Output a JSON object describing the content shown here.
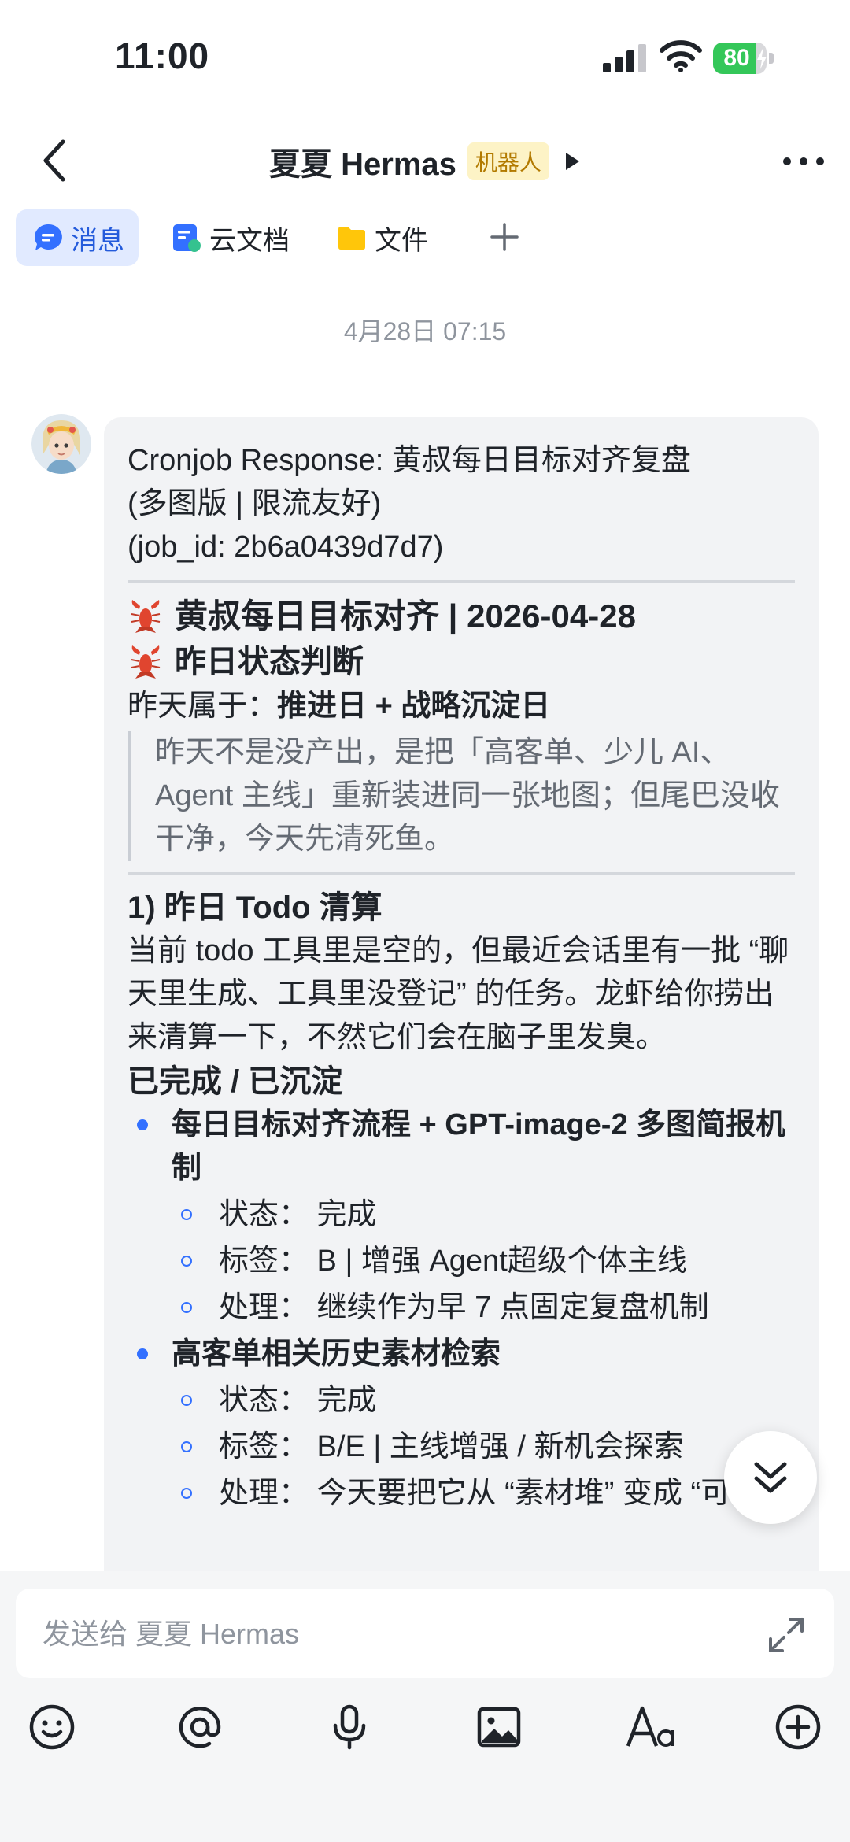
{
  "status_bar": {
    "time": "11:00",
    "battery": 80
  },
  "header": {
    "title": "夏夏 Hermas",
    "badge": "机器人"
  },
  "tabs": [
    {
      "label": "消息",
      "active": true
    },
    {
      "label": "云文档"
    },
    {
      "label": "文件"
    }
  ],
  "timestamp": "4月28日 07:15",
  "message": {
    "intro": [
      "Cronjob Response: 黄叔每日目标对齐复盘",
      "(多图版 | 限流友好)",
      "(job_id: 2b6a0439d7d7)"
    ],
    "heading1": "黄叔每日目标对齐 | 2026-04-28",
    "heading2": "昨日状态判断",
    "day_type_label": "昨天属于：",
    "day_type_value": "推进日 + 战略沉淀日",
    "quote": "昨天不是没产出，是把「高客单、少儿 AI、Agent 主线」重新装进同一张地图；但尾巴没收干净，今天先清死鱼。",
    "section1_title": "1) 昨日 Todo 清算",
    "section1_body": "当前 todo 工具里是空的，但最近会话里有一批 “聊天里生成、工具里没登记” 的任务。龙虾给你捞出来清算一下，不然它们会在脑子里发臭。",
    "done_title": "已完成 / 已沉淀",
    "items": [
      {
        "title": "每日目标对齐流程 + GPT-image-2 多图简报机制",
        "subs": [
          "状态：  完成",
          "标签：  B | 增强 Agent超级个体主线",
          "处理：  继续作为早 7 点固定复盘机制"
        ]
      },
      {
        "title": "高客单相关历史素材检索",
        "subs": [
          "状态：  完成",
          "标签：  B/E | 主线增强 / 新机会探索",
          "处理：  今天要把它从 “素材堆” 变成 “可"
        ]
      }
    ]
  },
  "input": {
    "placeholder": "发送给 夏夏 Hermas"
  },
  "colors": {
    "accent": "#3370ff",
    "bubble": "#f2f3f5",
    "badge_bg": "#fdf3c6",
    "badge_text": "#b27a00"
  },
  "icons": [
    "back-arrow-icon",
    "more-icon",
    "message-icon",
    "doc-icon",
    "folder-icon",
    "plus-icon",
    "crayfish-icon",
    "chevron-double-down-icon",
    "expand-icon",
    "emoji-icon",
    "at-icon",
    "microphone-icon",
    "image-icon",
    "font-icon",
    "add-circle-icon"
  ]
}
